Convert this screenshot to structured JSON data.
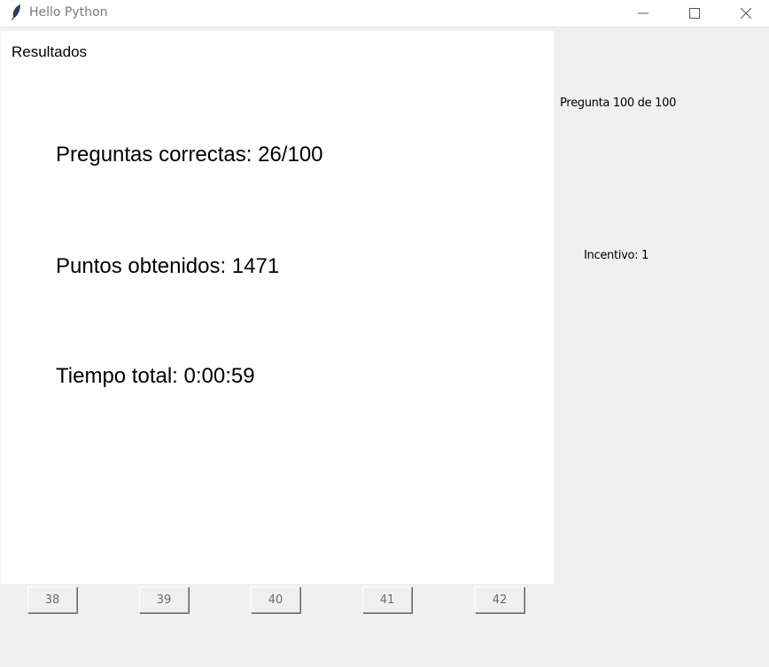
{
  "window": {
    "title": "Hello Python",
    "icons": {
      "app": "feather-icon",
      "minimize": "minimize-icon",
      "maximize": "maximize-icon",
      "close": "close-icon"
    }
  },
  "main": {
    "title": "Resultados",
    "correct": "Preguntas correctas: 26/100",
    "points": "Puntos obtenidos: 1471",
    "time": "Tiempo total: 0:00:59"
  },
  "side": {
    "question": "Pregunta 100 de 100",
    "incentive": "Incentivo: 1"
  },
  "buttons": [
    "38",
    "39",
    "40",
    "41",
    "42"
  ],
  "colors": {
    "window_bg": "#f0f0f0",
    "panel_bg": "#ffffff",
    "title_text": "#7a7a7a",
    "button_text": "#6d6d6d"
  }
}
